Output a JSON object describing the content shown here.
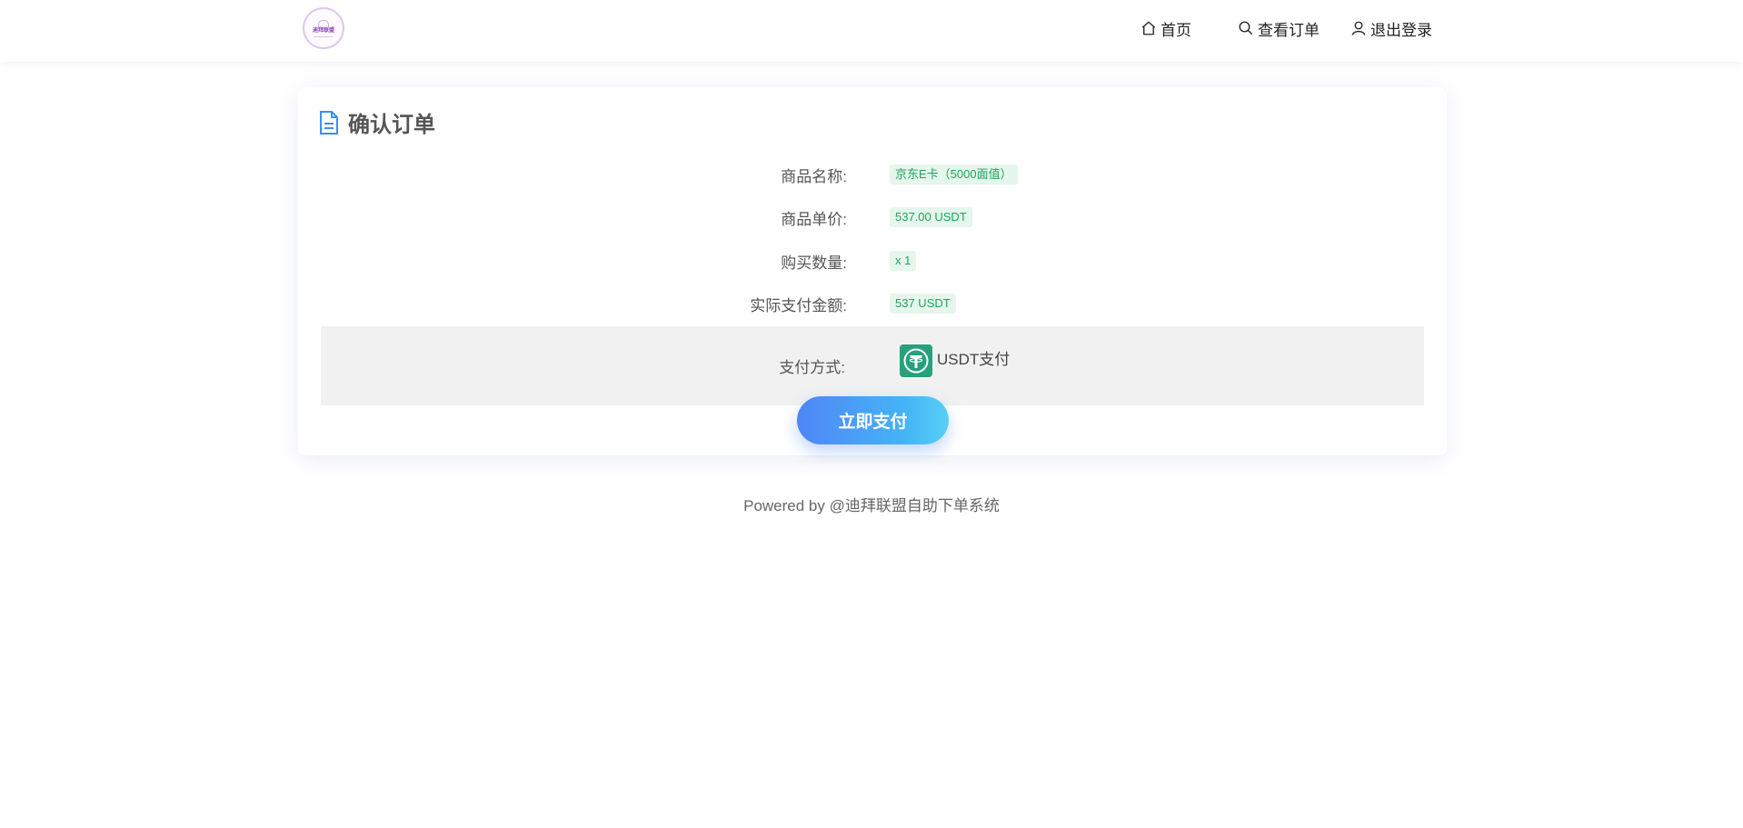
{
  "header": {
    "logo_text": "迪拜联盟",
    "nav": {
      "home": "首页",
      "orders": "查看订单",
      "logout": "退出登录"
    }
  },
  "order": {
    "title": "确认订单",
    "rows": [
      {
        "label": "商品名称:",
        "value": "京东E卡（5000面值）"
      },
      {
        "label": "商品单价:",
        "value": "537.00 USDT"
      },
      {
        "label": "购买数量:",
        "value": "x 1"
      },
      {
        "label": "实际支付金额:",
        "value": "537 USDT"
      }
    ],
    "payment": {
      "label": "支付方式:",
      "method": "USDT支付",
      "icon": "usdt-tether-icon"
    },
    "pay_button": "立即支付"
  },
  "footer": {
    "text": "Powered by @迪拜联盟自助下单系统"
  },
  "colors": {
    "tag_text": "#1ea55c",
    "tag_bg": "#e5f6ec",
    "accent": "#4f86f7",
    "usdt_green": "#26a17b"
  }
}
